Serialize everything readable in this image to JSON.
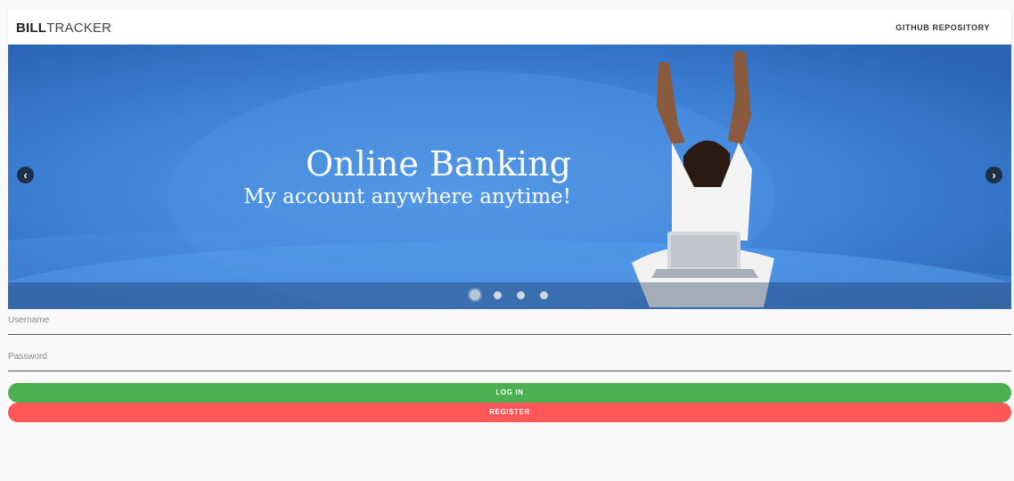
{
  "navbar": {
    "brand_bold": "BILL",
    "brand_light": "TRACKER",
    "link": "GITHUB REPOSITORY"
  },
  "carousel": {
    "title": "Online Banking",
    "subtitle": "My account anywhere anytime!",
    "prev_icon": "chevron-left-icon",
    "next_icon": "chevron-right-icon",
    "prev_glyph": "‹",
    "next_glyph": "›",
    "slide_count": 4,
    "active_slide": 1
  },
  "form": {
    "username_placeholder": "Username",
    "password_placeholder": "Password",
    "login_label": "LOG IN",
    "register_label": "REGISTER"
  },
  "colors": {
    "login": "#4caf50",
    "register": "#ff5757",
    "banner": "#3f82d6"
  }
}
